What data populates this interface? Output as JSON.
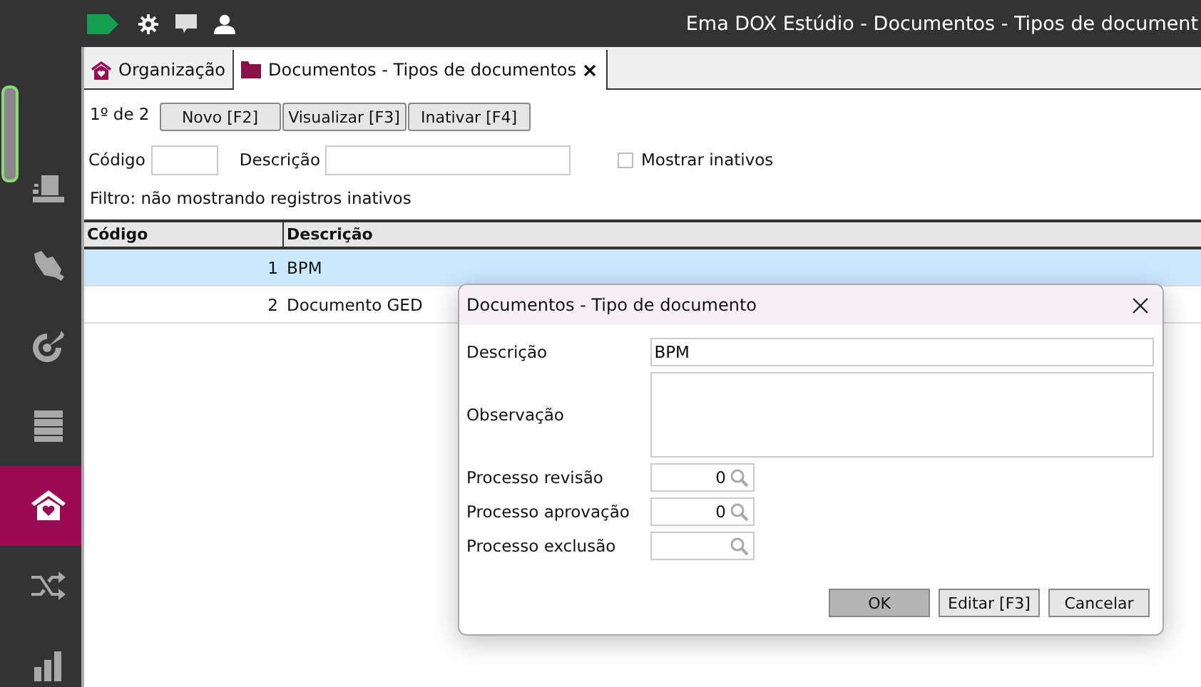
{
  "top_bar": {
    "title": "Ema DOX Estúdio - Documentos - Tipos de document"
  },
  "sidebar": {
    "items": [
      {
        "selected": false
      },
      {
        "selected": false
      },
      {
        "selected": false
      },
      {
        "selected": false
      },
      {
        "selected": true
      },
      {
        "selected": false
      },
      {
        "selected": false
      }
    ]
  },
  "tabs": [
    {
      "label": "Organização",
      "selected": false,
      "closable": false
    },
    {
      "label": "Documentos - Tipos de documentos",
      "selected": true,
      "closable": true
    }
  ],
  "toolbar": {
    "record_count": "1º de 2",
    "buttons": [
      "Novo [F2]",
      "Visualizar [F3]",
      "Inativar [F4]"
    ]
  },
  "filters": {
    "fields": [
      {
        "label": "Código"
      },
      {
        "label": "Descrição"
      }
    ],
    "checkbox": {
      "label": "Mostrar inativos",
      "checked": false
    },
    "status": "Filtro:  não mostrando registros inativos"
  },
  "table": {
    "columns": [
      "Código",
      "Descrição"
    ],
    "rows": [
      {
        "code": "1",
        "description": "BPM",
        "selected": true
      },
      {
        "code": "2",
        "description": "Documento GED",
        "selected": false
      }
    ]
  },
  "dialog": {
    "title": "Documentos - Tipo de documento",
    "fields": [
      {
        "kind": "text",
        "label": "Descrição",
        "value": "BPM"
      },
      {
        "kind": "textarea",
        "label": "Observação"
      },
      {
        "kind": "lookup",
        "label": "Processo revisão",
        "value": "0"
      },
      {
        "kind": "lookup",
        "label": "Processo aprovação",
        "value": "0"
      },
      {
        "kind": "lookup",
        "label": "Processo exclusão"
      }
    ],
    "buttons": [
      {
        "label": "OK",
        "default": true
      },
      {
        "label": "Editar [F3]",
        "default": false
      },
      {
        "label": "Cancelar",
        "default": false
      }
    ]
  }
}
